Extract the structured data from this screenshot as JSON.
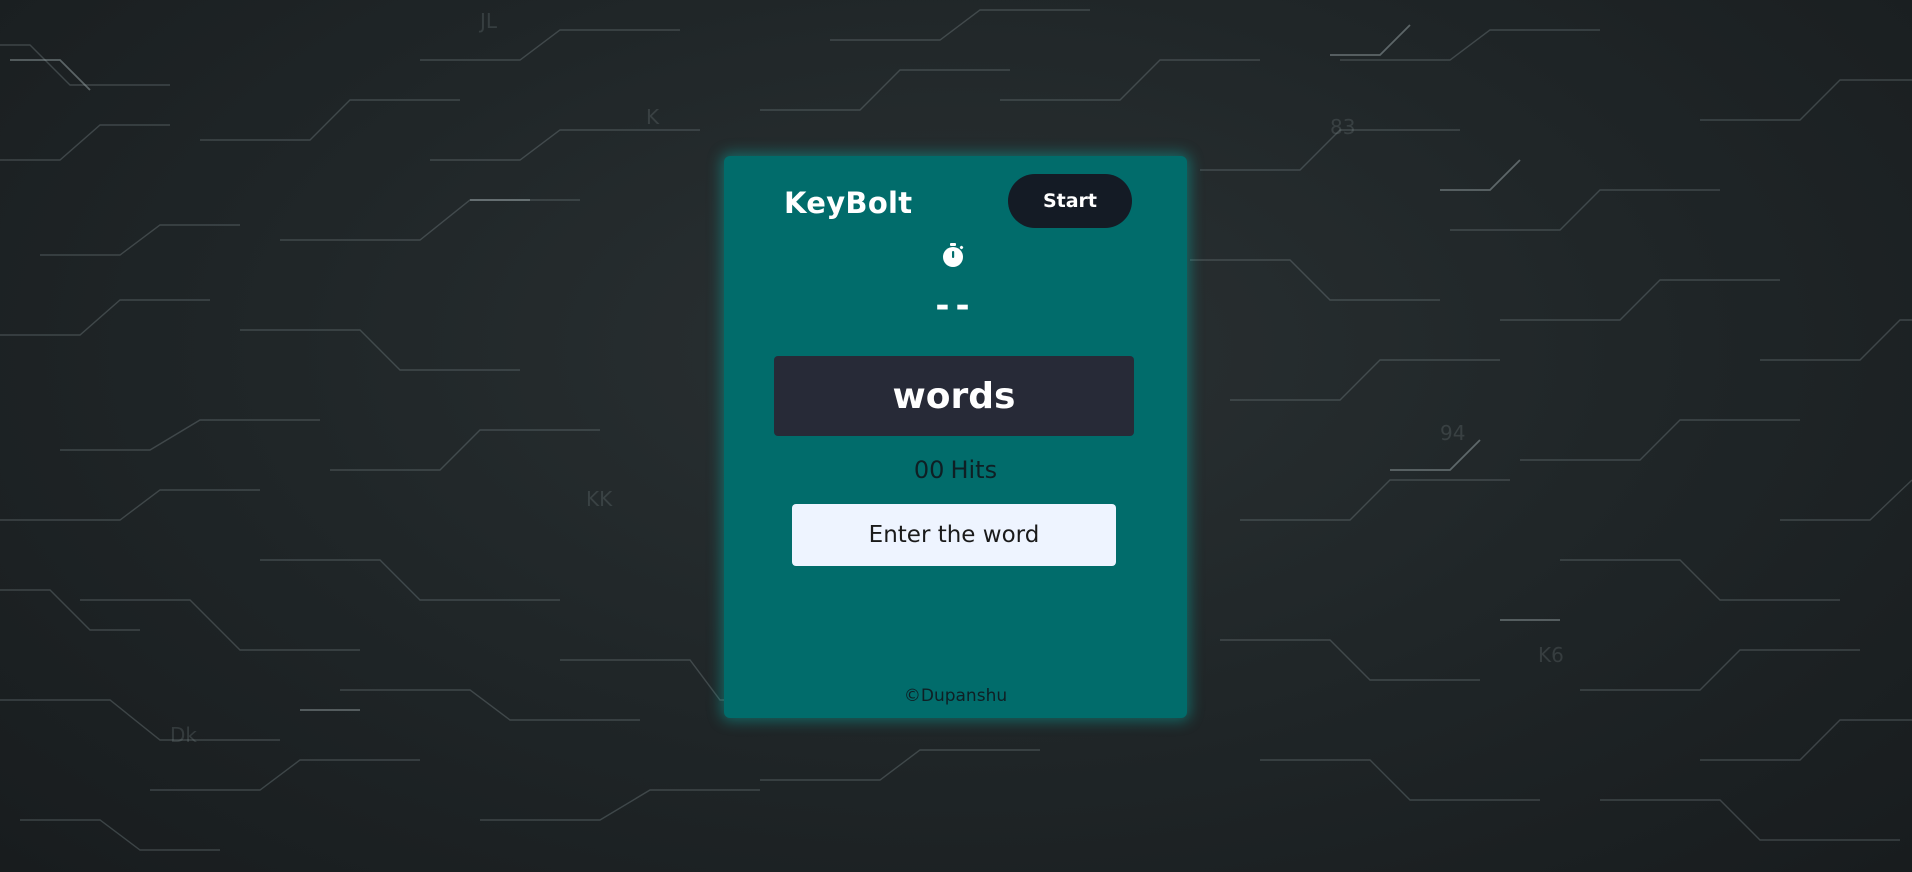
{
  "app": {
    "title": "KeyBolt",
    "start_label": "Start"
  },
  "timer": {
    "icon": "stopwatch-icon",
    "value": "--"
  },
  "game": {
    "current_word": "words",
    "hits_count": "00",
    "hits_label": "Hits"
  },
  "input": {
    "placeholder": "Enter the word",
    "value": ""
  },
  "footer": {
    "copyright": "©Dupanshu"
  },
  "colors": {
    "card_background": "#016c6b",
    "start_button": "#141b25",
    "word_box": "#272a37",
    "input_background": "#eef4ff",
    "page_background": "#1f2527"
  }
}
